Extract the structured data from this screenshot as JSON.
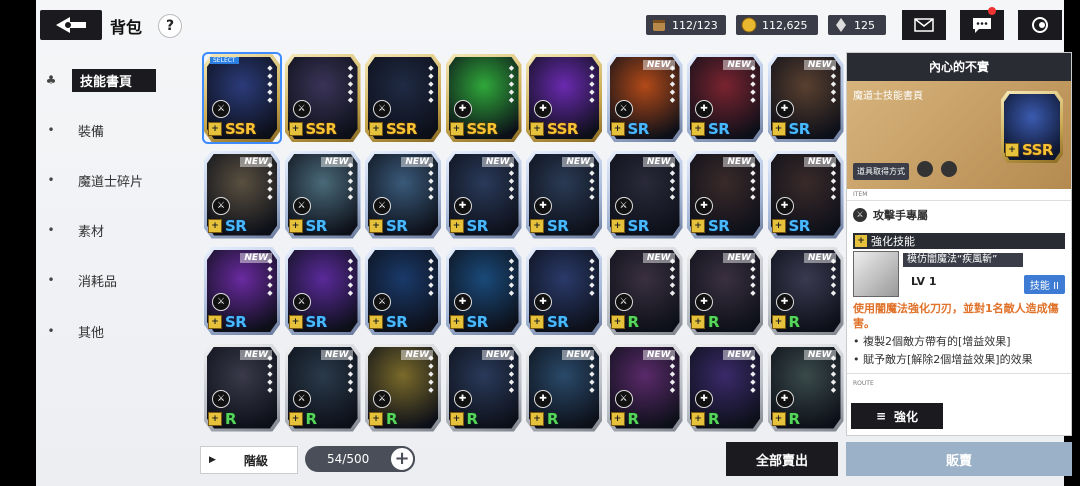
{
  "header": {
    "title": "背包",
    "help": "?"
  },
  "resources": [
    {
      "icon": "stamina-icon",
      "value": "112/123"
    },
    {
      "icon": "gold-coin-icon",
      "value": "112,625"
    },
    {
      "icon": "crystal-icon",
      "value": "125"
    }
  ],
  "sidebar": {
    "items": [
      {
        "label": "技能書頁",
        "active": true
      },
      {
        "label": "裝備"
      },
      {
        "label": "魔道士碎片"
      },
      {
        "label": "素材"
      },
      {
        "label": "消耗品"
      },
      {
        "label": "其他"
      }
    ]
  },
  "grid": {
    "select_tag": "SELECT",
    "new_tag": "NEW",
    "cards": [
      {
        "rarity": "SSR",
        "color": "#2b3b7a",
        "selected": true
      },
      {
        "rarity": "SSR",
        "color": "#3a3458"
      },
      {
        "rarity": "SSR",
        "color": "#1f2a44"
      },
      {
        "rarity": "SSR",
        "color": "#2fa83a"
      },
      {
        "rarity": "SSR",
        "color": "#6a2ab0"
      },
      {
        "rarity": "SR",
        "color": "#b24a18",
        "new": true
      },
      {
        "rarity": "SR",
        "color": "#7a2430",
        "new": true
      },
      {
        "rarity": "SR",
        "color": "#5a4030",
        "new": true
      },
      {
        "rarity": "SR",
        "color": "#5a5040",
        "new": true
      },
      {
        "rarity": "SR",
        "color": "#4a6a7a",
        "new": true
      },
      {
        "rarity": "SR",
        "color": "#3a5a7a",
        "new": true
      },
      {
        "rarity": "SR",
        "color": "#2a3a5a",
        "new": true
      },
      {
        "rarity": "SR",
        "color": "#2a3a55",
        "new": true
      },
      {
        "rarity": "SR",
        "color": "#2a2a3a",
        "new": true
      },
      {
        "rarity": "SR",
        "color": "#3a2a2a",
        "new": true
      },
      {
        "rarity": "SR",
        "color": "#3a2a2a",
        "new": true
      },
      {
        "rarity": "SR",
        "color": "#6a2aa0",
        "new": true
      },
      {
        "rarity": "SR",
        "color": "#5a2a9a"
      },
      {
        "rarity": "SR",
        "color": "#1a3a6a"
      },
      {
        "rarity": "SR",
        "color": "#1a4a7a"
      },
      {
        "rarity": "SR",
        "color": "#2a3a6a"
      },
      {
        "rarity": "R",
        "color": "#3a3040",
        "new": true
      },
      {
        "rarity": "R",
        "color": "#3a3040",
        "new": true
      },
      {
        "rarity": "R",
        "color": "#3a3a50",
        "new": true
      },
      {
        "rarity": "R",
        "color": "#3a3a4a",
        "new": true
      },
      {
        "rarity": "R",
        "color": "#2a3a4a",
        "new": true
      },
      {
        "rarity": "R",
        "color": "#7a6a2a",
        "new": true
      },
      {
        "rarity": "R",
        "color": "#2a3a5a",
        "new": true
      },
      {
        "rarity": "R",
        "color": "#2a4a6a",
        "new": true
      },
      {
        "rarity": "R",
        "color": "#5a2a6a",
        "new": true
      },
      {
        "rarity": "R",
        "color": "#3a2a6a",
        "new": true
      },
      {
        "rarity": "R",
        "color": "#3a4a4a",
        "new": true
      }
    ]
  },
  "bottom": {
    "sort_label": "階級",
    "count": "54/500",
    "sell_all": "全部賣出",
    "sell": "販賣"
  },
  "detail": {
    "title": "內心的不實",
    "type": "魔道士技能書頁",
    "rarity": "SSR",
    "get_way": "道具取得方式",
    "item_sub": "ITEM",
    "exclusive": "攻擊手專屬",
    "enhance_skill": "強化技能",
    "skill_name": "模仿闇魔法“疾風斬”",
    "level": "LV 1",
    "skill_tag": "技能 II",
    "description": "使用闇魔法強化刀刃，並對1名敵人造成傷害。",
    "bullets": [
      "• 複製2個敵方帶有的[增益效果]",
      "• 賦予敵方[解除2個增益效果]的效果"
    ],
    "route_sub": "ROUTE",
    "enhance_btn": "強化"
  }
}
